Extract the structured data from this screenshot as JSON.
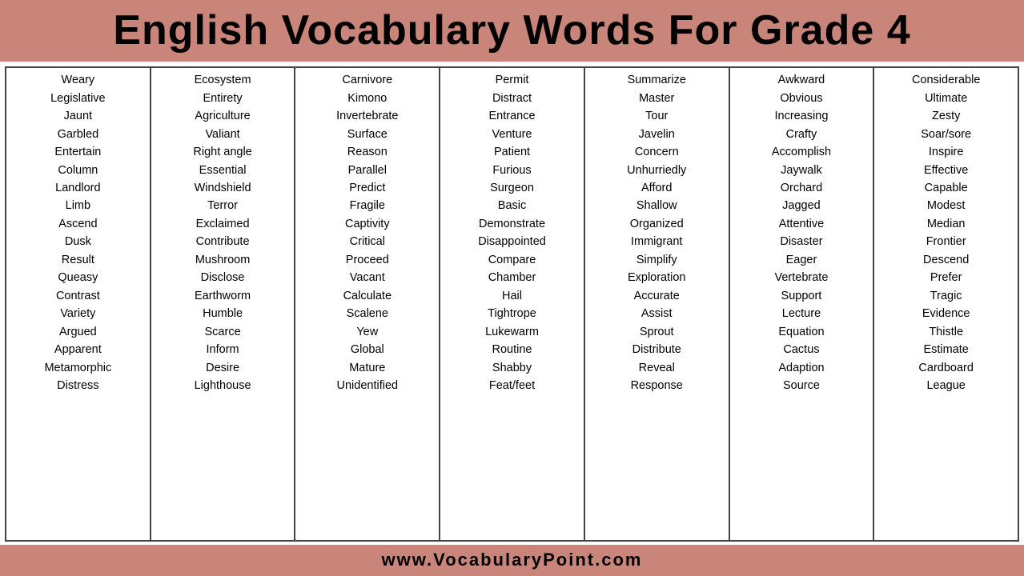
{
  "header": {
    "title": "English Vocabulary Words For Grade 4"
  },
  "columns": [
    {
      "words": [
        "Weary",
        "Legislative",
        "Jaunt",
        "Garbled",
        "Entertain",
        "Column",
        "Landlord",
        "Limb",
        "Ascend",
        "Dusk",
        "Result",
        "Queasy",
        "Contrast",
        "Variety",
        "Argued",
        "Apparent",
        "Metamorphic",
        "Distress"
      ]
    },
    {
      "words": [
        "Ecosystem",
        "Entirety",
        "Agriculture",
        "Valiant",
        "Right angle",
        "Essential",
        "Windshield",
        "Terror",
        "Exclaimed",
        "Contribute",
        "Mushroom",
        "Disclose",
        "Earthworm",
        "Humble",
        "Scarce",
        "Inform",
        "Desire",
        "Lighthouse"
      ]
    },
    {
      "words": [
        "Carnivore",
        "Kimono",
        "Invertebrate",
        "Surface",
        "Reason",
        "Parallel",
        "Predict",
        "Fragile",
        "Captivity",
        "Critical",
        "Proceed",
        "Vacant",
        "Calculate",
        "Scalene",
        "Yew",
        "Global",
        "Mature",
        "Unidentified"
      ]
    },
    {
      "words": [
        "Permit",
        "Distract",
        "Entrance",
        "Venture",
        "Patient",
        "Furious",
        "Surgeon",
        "Basic",
        "Demonstrate",
        "Disappointed",
        "Compare",
        "Chamber",
        "Hail",
        "Tightrope",
        "Lukewarm",
        "Routine",
        "Shabby",
        "Feat/feet"
      ]
    },
    {
      "words": [
        "Summarize",
        "Master",
        "Tour",
        "Javelin",
        "Concern",
        "Unhurriedly",
        "Afford",
        "Shallow",
        "Organized",
        "Immigrant",
        "Simplify",
        "Exploration",
        "Accurate",
        "Assist",
        "Sprout",
        "Distribute",
        "Reveal",
        "Response"
      ]
    },
    {
      "words": [
        "Awkward",
        "Obvious",
        "Increasing",
        "Crafty",
        "Accomplish",
        "Jaywalk",
        "Orchard",
        "Jagged",
        "Attentive",
        "Disaster",
        "Eager",
        "Vertebrate",
        "Support",
        "Lecture",
        "Equation",
        "Cactus",
        "Adaption",
        "Source"
      ]
    },
    {
      "words": [
        "Considerable",
        "Ultimate",
        "Zesty",
        "Soar/sore",
        "Inspire",
        "Effective",
        "Capable",
        "Modest",
        "Median",
        "Frontier",
        "Descend",
        "Prefer",
        "Tragic",
        "Evidence",
        "Thistle",
        "Estimate",
        "Cardboard",
        "League"
      ]
    }
  ],
  "footer": {
    "url": "www.VocabularyPoint.com"
  }
}
